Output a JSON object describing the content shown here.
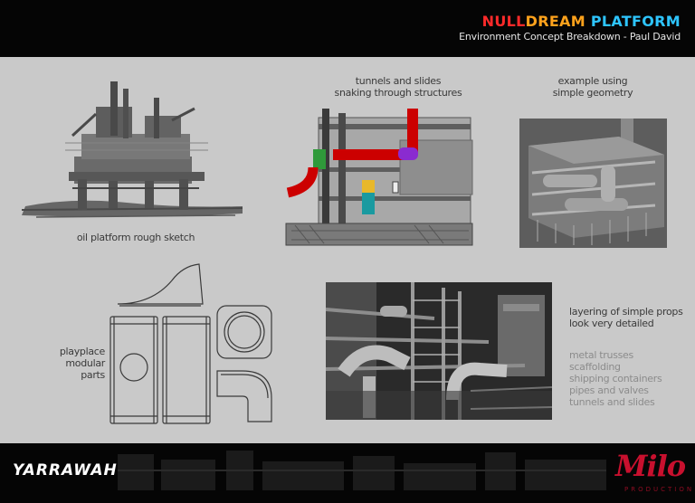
{
  "header": {
    "title_words": [
      "NULL",
      "DREAM",
      "PLATFORM"
    ],
    "subtitle": "Environment Concept Breakdown - Paul David"
  },
  "labels": {
    "oil_sketch": "oil platform rough sketch",
    "tunnels_line1": "tunnels and slides",
    "tunnels_line2": "snaking through structures",
    "geometry_line1": "example using",
    "geometry_line2": "simple geometry",
    "playplace_line1": "playplace",
    "playplace_line2": "modular",
    "playplace_line3": "parts",
    "layering_line1": "layering of simple props",
    "layering_line2": "look very detailed"
  },
  "props_list": [
    "metal trusses",
    "scaffolding",
    "shipping containers",
    "pipes and valves",
    "tunnels and slides"
  ],
  "footer": {
    "left_logo_text": "YARRAWAH",
    "right_logo_text": "Milo",
    "right_logo_sub": "PRODUCTION"
  },
  "colors": {
    "title_null": "#ff2a2a",
    "title_dream": "#ffa21c",
    "title_platform": "#2ec5ff",
    "slide_red": "#cc0000",
    "slide_green": "#2f9a3a",
    "slide_purple": "#8a2bd0",
    "slide_yellow": "#e8b82a",
    "slide_teal": "#1a9aa0",
    "milo_red": "#c8102e"
  }
}
